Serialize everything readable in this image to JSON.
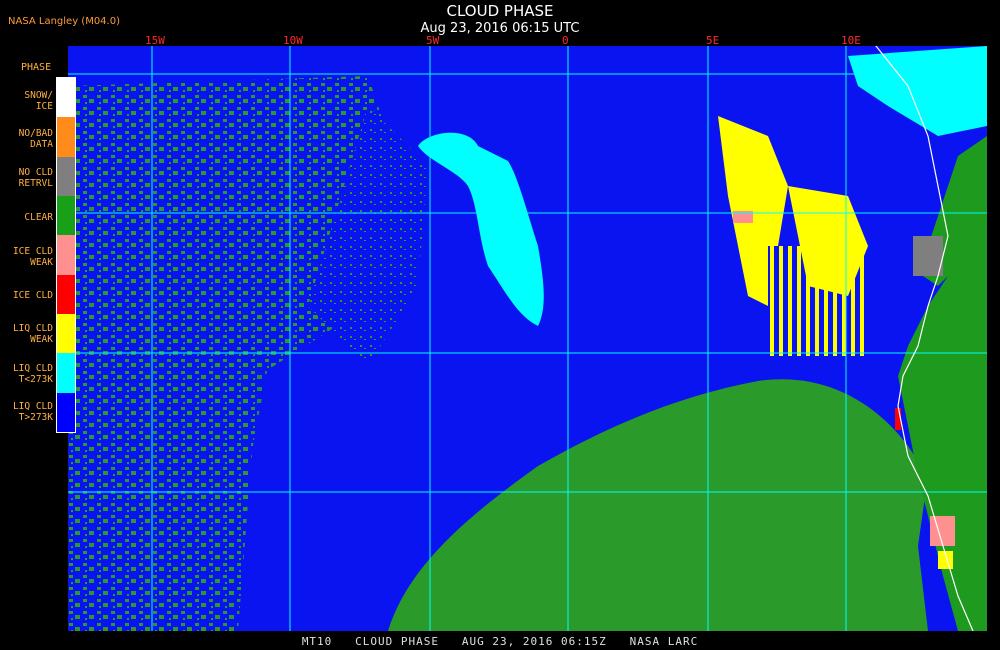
{
  "header": {
    "credit": "NASA Langley (M04.0)",
    "title": "CLOUD PHASE",
    "subtitle": "Aug 23, 2016 06:15 UTC"
  },
  "longitude_labels": [
    "15W",
    "10W",
    "5W",
    "0",
    "5E",
    "10E"
  ],
  "legend": {
    "title": "PHASE",
    "items": [
      {
        "label": "SNOW/\nICE",
        "color": "#ffffff"
      },
      {
        "label": "NO/BAD\nDATA",
        "color": "#ff8c1a"
      },
      {
        "label": "NO CLD\nRETRVL",
        "color": "#7f7f7f"
      },
      {
        "label": "CLEAR",
        "color": "#18a018"
      },
      {
        "label": "ICE CLD\nWEAK",
        "color": "#ff9090"
      },
      {
        "label": "ICE CLD",
        "color": "#ff0000"
      },
      {
        "label": "LIQ CLD\nWEAK",
        "color": "#ffff00"
      },
      {
        "label": "LIQ CLD\nT<273K",
        "color": "#00ffff"
      },
      {
        "label": "LIQ CLD\nT>273K",
        "color": "#0000ff"
      }
    ]
  },
  "colors": {
    "ocean_liquid": "#0a14f0",
    "clear": "#2a9a2a",
    "land": "#1e9a1e",
    "supercooled": "#00ffff",
    "weak_liquid": "#ffff00",
    "ice_weak": "#ff9090",
    "ice": "#ff0000",
    "grid": "#00ffff",
    "coastline": "#ffffff"
  },
  "footer": "MT10   CLOUD PHASE   AUG 23, 2016 06:15Z   NASA LARC"
}
